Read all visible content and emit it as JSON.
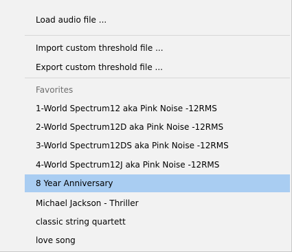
{
  "menu": {
    "items": [
      {
        "label": "Load audio file ..."
      },
      {
        "label": "Import custom threshold file ..."
      },
      {
        "label": "Export custom threshold file ..."
      }
    ],
    "favorites_header": "Favorites",
    "favorites": [
      {
        "label": "1-World Spectrum12 aka Pink Noise -12RMS"
      },
      {
        "label": "2-World Spectrum12D aka Pink Noise -12RMS"
      },
      {
        "label": "3-World Spectrum12DS aka Pink Noise -12RMS"
      },
      {
        "label": "4-World Spectrum12J aka Pink Noise -12RMS"
      },
      {
        "label": "8 Year Anniversary",
        "highlighted": true
      },
      {
        "label": "Michael Jackson - Thriller"
      },
      {
        "label": "classic string quartett"
      },
      {
        "label": "love song"
      }
    ],
    "highlight_color": "#a9cdf2",
    "background_color": "#f2f2f2"
  }
}
